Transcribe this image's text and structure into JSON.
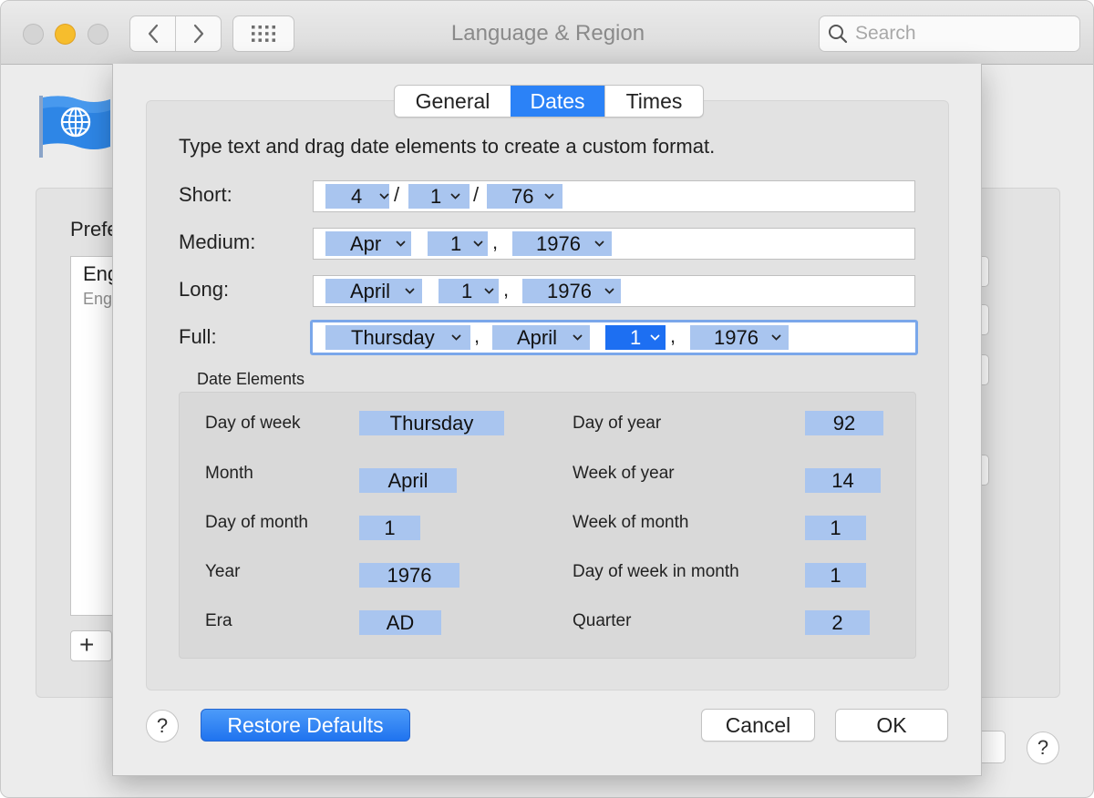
{
  "window": {
    "title": "Language & Region",
    "search_placeholder": "Search"
  },
  "background": {
    "preferred_label": "Prefe",
    "language_primary": "Eng",
    "language_secondary": "Eng",
    "add_label": "+",
    "help_label": "?"
  },
  "sheet": {
    "tabs": [
      "General",
      "Dates",
      "Times"
    ],
    "active_tab": "Dates",
    "instruction": "Type text and drag date elements to create a custom format.",
    "formats": {
      "short": {
        "label": "Short:",
        "tokens": [
          "4",
          "1",
          "76"
        ],
        "separators": [
          "/",
          "/"
        ]
      },
      "medium": {
        "label": "Medium:",
        "tokens": [
          "Apr",
          "1",
          "1976"
        ],
        "separators": [
          ","
        ]
      },
      "long": {
        "label": "Long:",
        "tokens": [
          "April",
          "1",
          "1976"
        ],
        "separators": [
          ","
        ]
      },
      "full": {
        "label": "Full:",
        "tokens": [
          "Thursday",
          "April",
          "1",
          "1976"
        ],
        "separators": [
          ",",
          ","
        ],
        "selected_token": "1"
      }
    },
    "date_elements": {
      "title": "Date Elements",
      "left": [
        {
          "label": "Day of week",
          "value": "Thursday"
        },
        {
          "label": "Month",
          "value": "April"
        },
        {
          "label": "Day of month",
          "value": "1"
        },
        {
          "label": "Year",
          "value": "1976"
        },
        {
          "label": "Era",
          "value": "AD"
        }
      ],
      "right": [
        {
          "label": "Day of year",
          "value": "92"
        },
        {
          "label": "Week of year",
          "value": "14"
        },
        {
          "label": "Week of month",
          "value": "1"
        },
        {
          "label": "Day of week in month",
          "value": "1"
        },
        {
          "label": "Quarter",
          "value": "2"
        }
      ]
    },
    "buttons": {
      "help": "?",
      "restore": "Restore Defaults",
      "cancel": "Cancel",
      "ok": "OK"
    }
  },
  "colors": {
    "accent": "#2b82f7",
    "token": "#a9c5ef",
    "token_selected": "#1d6ff2"
  }
}
